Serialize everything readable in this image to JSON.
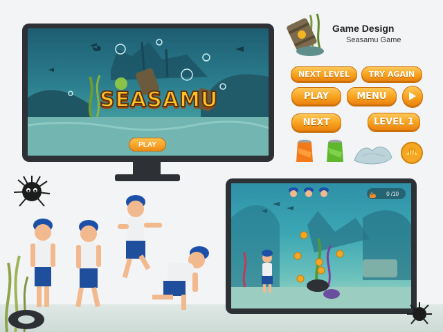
{
  "header": {
    "title": "Game Design",
    "subtitle": "Seasamu Game"
  },
  "monitor_screen": {
    "logo": "SEASAMU",
    "play_label": "PLAY"
  },
  "ui_buttons": {
    "next_level": "NEXT LEVEL",
    "try_again": "TRY AGAIN",
    "play": "PLAY",
    "menu": "MENU",
    "next": "NEXT",
    "level_1": "LEVEL 1"
  },
  "tablet_hud": {
    "score": "0 /10"
  },
  "icons": [
    "radioactive-barrel-icon",
    "play-arrow-icon",
    "orange-can-icon",
    "green-can-icon",
    "plastic-bag-icon",
    "gold-shell-coin-icon",
    "sea-urchin-icon",
    "fish-icon",
    "bubble-icon"
  ],
  "colors": {
    "accent": "#f7a21d",
    "frame": "#2d3136",
    "sea": "#2b7f8f"
  }
}
